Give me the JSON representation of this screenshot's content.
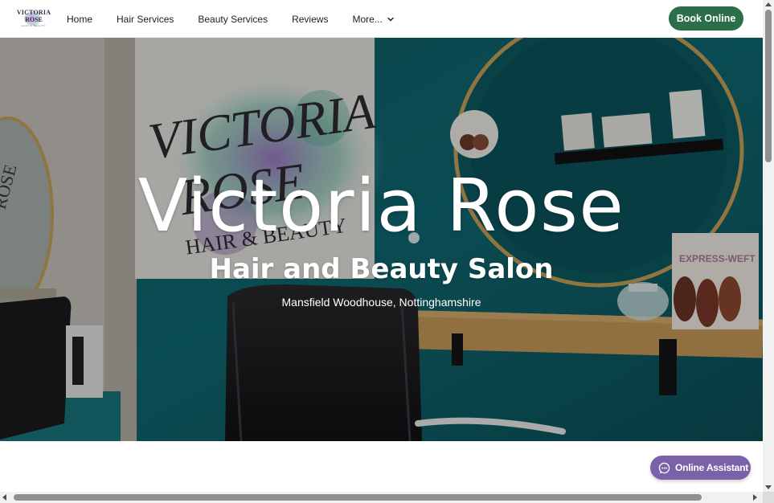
{
  "header": {
    "logo": {
      "line1": "VICTORIA",
      "line2": "ROSE",
      "line3": "HAIR & BEAUTY"
    },
    "nav": [
      {
        "label": "Home"
      },
      {
        "label": "Hair Services"
      },
      {
        "label": "Beauty Services"
      },
      {
        "label": "Reviews"
      },
      {
        "label": "More..."
      }
    ],
    "book_button": "Book Online"
  },
  "hero": {
    "title": "Victoria Rose",
    "subtitle": "Hair and Beauty Salon",
    "location": "Mansfield Woodhouse, Nottinghamshire",
    "background_colors": {
      "wall": "#0f6a73",
      "shelf": "#c89a5a",
      "mirror_frame": "#c9a25a"
    },
    "scene_text": {
      "sign_line1": "VICTORIA",
      "sign_line2": "ROSE",
      "sign_line3": "HAIR & BEAUTY",
      "poster": "EXPRESS-WEFT"
    }
  },
  "assistant": {
    "label": "Online Assistant",
    "icon": "chat-bubble-icon"
  },
  "colors": {
    "accent_green": "#2c6e49",
    "accent_purple": "#7b61a8"
  }
}
